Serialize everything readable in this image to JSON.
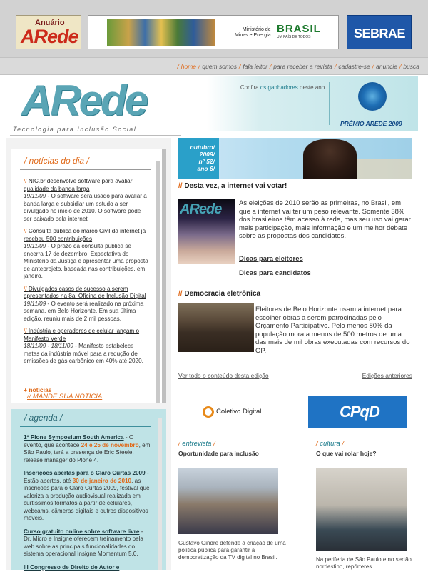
{
  "banner": {
    "anuario_top": "Anuário",
    "anuario_logo": "ARede",
    "ministerio_text": "Ministério de\nMinas e Energia",
    "brasil_text": "BRASIL",
    "brasil_sub": "UM PAÍS DE TODOS",
    "sebrae_text": "SEBRAE"
  },
  "nav": {
    "items": [
      "home",
      "quem somos",
      "fala leitor",
      "para receber a revista",
      "cadastre-se",
      "anuncie",
      "busca"
    ]
  },
  "masthead": {
    "logo": "ARede",
    "tagline": "Tecnologia para Inclusão Social",
    "premio_pre": "Confira",
    "premio_link": "os ganhadores",
    "premio_post": "deste ano",
    "premio_label": "PRÊMIO AREDE 2009"
  },
  "news": {
    "title": "/ notícias do dia /",
    "items": [
      {
        "headline": "NIC.br desenvolve software para avaliar qualidade da banda larga",
        "date": "19/11/09",
        "body": " - O software será usado para avaliar a banda larga e subsidiar um estudo a ser divulgado no início de 2010. O software pode ser baixado pela internet"
      },
      {
        "headline": "Consulta pública do marco Civil da internet já recebeu 500 contribuições",
        "date": "19/11/09",
        "body": " - O prazo da consulta pública se encerra 17 de dezembro. Expectativa do Ministério da Justiça é apresentar uma proposta de anteprojeto, baseada nas contribuições, em janeiro."
      },
      {
        "headline": "Divulgados casos de sucesso a serem apresentados na 8a. Oficina de Inclusão Digital",
        "date": "19/11/09",
        "body": " - O evento será realizado na próxima semana, em Belo Horizonte. Em sua última edição, reuniu mais de 2 mil pessoas."
      },
      {
        "headline": "Indústria e operadores de celular lançam o Manifesto Verde",
        "date": "18/11/09 - 18/11/09",
        "body": " - Manifesto estabelece metas da indústria móvel para a redução de emissões de gás carbônico em 40% até 2020."
      }
    ],
    "more": "+ notícias",
    "mande": "MANDE SUA NOTÍCIA"
  },
  "agenda": {
    "title": "/ agenda /",
    "items": [
      {
        "headline": "1º Plone Symposium South America",
        "pre": " - O evento, que acontece ",
        "hl": "24 e 25 de novembro",
        "post": ", em São Paulo, terá a presença de Eric Steele, release manager do Plone 4."
      },
      {
        "headline": "Inscrições abertas para o Claro Curtas 2009",
        "pre": " - Estão abertas, até ",
        "hl": "30 de janeiro de 2010",
        "post": ", as inscrições para o Claro Curtas 2009, festival que valoriza a produção audiovisual realizada em curtíssimos formatos a partir de celulares, webcams, câmeras digitais e outros dispositivos móveis."
      },
      {
        "headline": "Curso gratuito online sobre software livre",
        "pre": " - Dr. Micro e Insigne oferecem treinamento pela web sobre as principais funcionalidades do sistema operacional Insigne Momentum 5.0.",
        "hl": "",
        "post": ""
      },
      {
        "headline": "III Congresso de Direito de Autor e",
        "pre": "",
        "hl": "",
        "post": ""
      }
    ]
  },
  "edition": {
    "tag": "outubro/\n2009/\nnº 52/\nano 6/"
  },
  "main": {
    "s1_title": "Desta vez, a internet vai votar!",
    "s1_img_text": "ARede",
    "s1_text": "As eleições de 2010 serão as primeiras, no Brasil, em que a internet vai ter um peso relevante. Somente 38% dos brasileiros têm acesso à rede, mas seu uso vai gerar mais participação, mais informação e um melhor debate sobre as propostas dos candidatos.",
    "s1_link1": "Dicas para eleitores",
    "s1_link2": "Dicas para candidatos",
    "s2_title": "Democracia eletrônica",
    "s2_text": "Eleitores de Belo Horizonte usam a internet para escolher obras a serem patrocinadas pelo Orçamento Participativo. Pelo menos 80% da população mora a menos de 500 metros de uma das mais de mil obras executadas com recursos do OP.",
    "all_content": "Ver todo o conteúdo desta edição",
    "previous": "Edições anteriores",
    "sponsor_cd": "Coletivo Digital",
    "sponsor_cpp": "CPqD",
    "entrevista_title": "entrevista",
    "entrevista_sub": "Oportunidade para inclusão",
    "entrevista_caption": "Gustavo Gindre defende a criação de uma política pública para garantir a democratização da TV digital no Brasil.",
    "cultura_title": "cultura",
    "cultura_sub": "O que vai rolar hoje?",
    "cultura_caption": "Na periferia de São Paulo e no sertão nordestino, repórteres"
  }
}
